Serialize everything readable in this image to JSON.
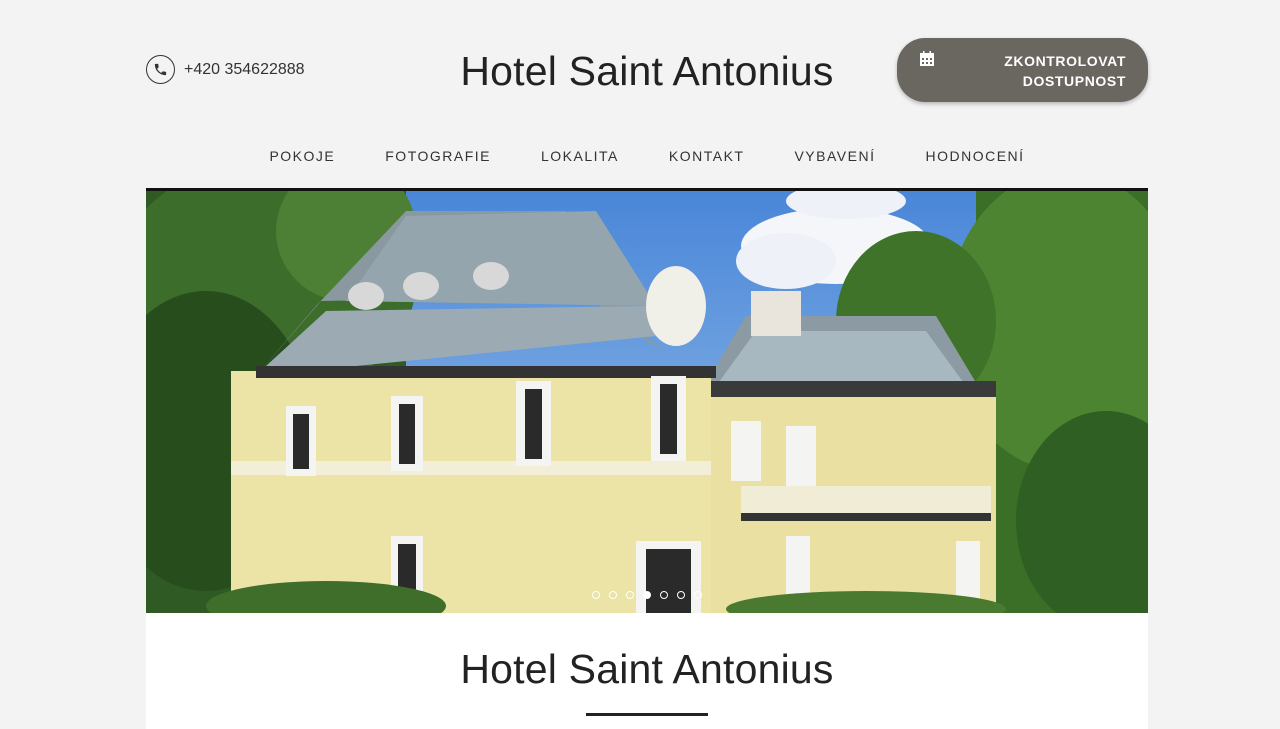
{
  "header": {
    "phone": "+420 354622888",
    "title": "Hotel Saint Antonius",
    "cta_line1": "ZKONTROLOVAT",
    "cta_line2": "DOSTUPNOST"
  },
  "nav": [
    "POKOJE",
    "FOTOGRAFIE",
    "LOKALITA",
    "KONTAKT",
    "VYBAVENÍ",
    "HODNOCENÍ"
  ],
  "slider": {
    "total": 7,
    "active_index": 3
  },
  "content": {
    "heading": "Hotel Saint Antonius"
  },
  "icons": {
    "phone": "phone-icon",
    "calendar": "calendar-icon"
  },
  "colors": {
    "cta_bg": "#6a6760",
    "page_bg": "#f3f3f3"
  }
}
